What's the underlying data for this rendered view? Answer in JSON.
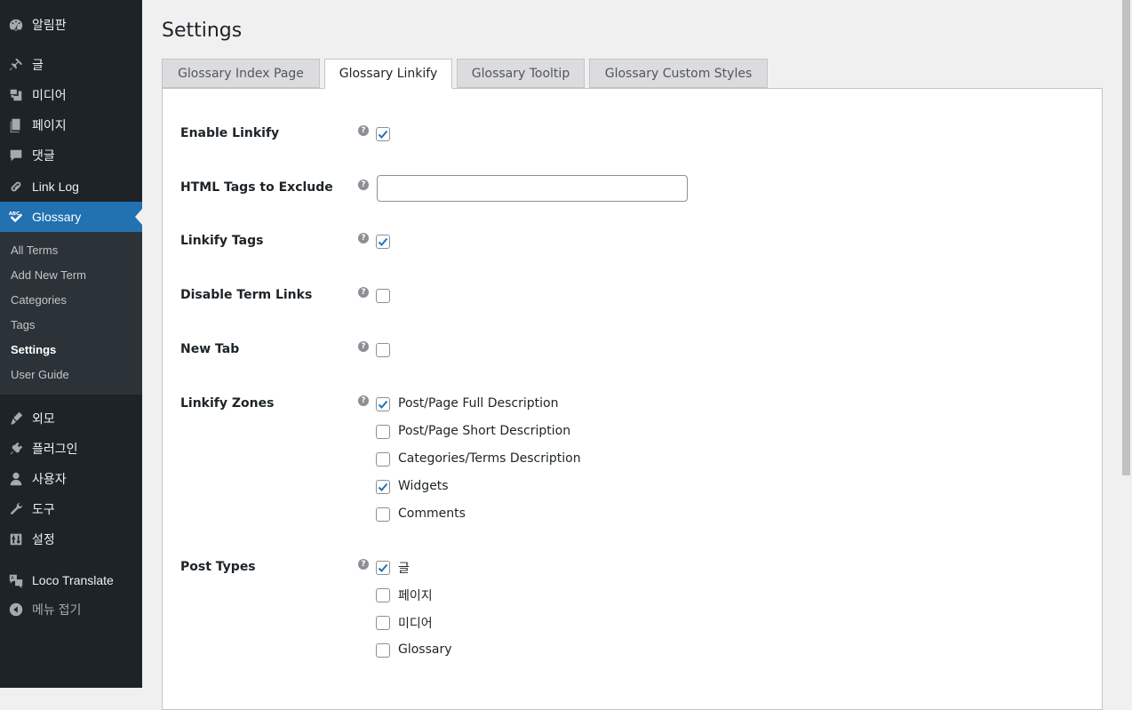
{
  "sidebar": {
    "items": [
      {
        "label": "알림판",
        "icon": "dashboard-icon"
      },
      {
        "label": "글",
        "icon": "pin-icon"
      },
      {
        "label": "미디어",
        "icon": "media-icon"
      },
      {
        "label": "페이지",
        "icon": "pages-icon"
      },
      {
        "label": "댓글",
        "icon": "comments-icon"
      },
      {
        "label": "Link Log",
        "icon": "link-icon"
      },
      {
        "label": "Glossary",
        "icon": "glossary-abc-icon",
        "active": true
      },
      {
        "label": "외모",
        "icon": "appearance-icon"
      },
      {
        "label": "플러그인",
        "icon": "plugins-icon"
      },
      {
        "label": "사용자",
        "icon": "users-icon"
      },
      {
        "label": "도구",
        "icon": "tools-icon"
      },
      {
        "label": "설정",
        "icon": "settings-icon"
      },
      {
        "label": "Loco Translate",
        "icon": "translate-icon"
      },
      {
        "label": "메뉴 접기",
        "icon": "collapse-icon"
      }
    ],
    "submenu": [
      "All Terms",
      "Add New Term",
      "Categories",
      "Tags",
      "Settings",
      "User Guide"
    ],
    "submenu_current": "Settings"
  },
  "page": {
    "title": "Settings",
    "tabs": [
      "Glossary Index Page",
      "Glossary Linkify",
      "Glossary Tooltip",
      "Glossary Custom Styles"
    ],
    "active_tab": "Glossary Linkify"
  },
  "form": {
    "help_glyph": "?",
    "enable_linkify": {
      "label": "Enable Linkify",
      "checked": true
    },
    "html_tags_exclude": {
      "label": "HTML Tags to Exclude",
      "value": ""
    },
    "linkify_tags": {
      "label": "Linkify Tags",
      "checked": true
    },
    "disable_term_links": {
      "label": "Disable Term Links",
      "checked": false
    },
    "new_tab": {
      "label": "New Tab",
      "checked": false
    },
    "linkify_zones": {
      "label": "Linkify Zones",
      "options": [
        {
          "label": "Post/Page Full Description",
          "checked": true
        },
        {
          "label": "Post/Page Short Description",
          "checked": false
        },
        {
          "label": "Categories/Terms Description",
          "checked": false
        },
        {
          "label": "Widgets",
          "checked": true
        },
        {
          "label": "Comments",
          "checked": false
        }
      ]
    },
    "post_types": {
      "label": "Post Types",
      "options": [
        {
          "label": "글",
          "checked": true
        },
        {
          "label": "페이지",
          "checked": false
        },
        {
          "label": "미디어",
          "checked": false
        },
        {
          "label": "Glossary",
          "checked": false
        }
      ]
    }
  },
  "colors": {
    "sidebar_bg": "#1d2327",
    "submenu_bg": "#2c3338",
    "accent": "#2271b1",
    "checkmark": "#2271b1"
  }
}
